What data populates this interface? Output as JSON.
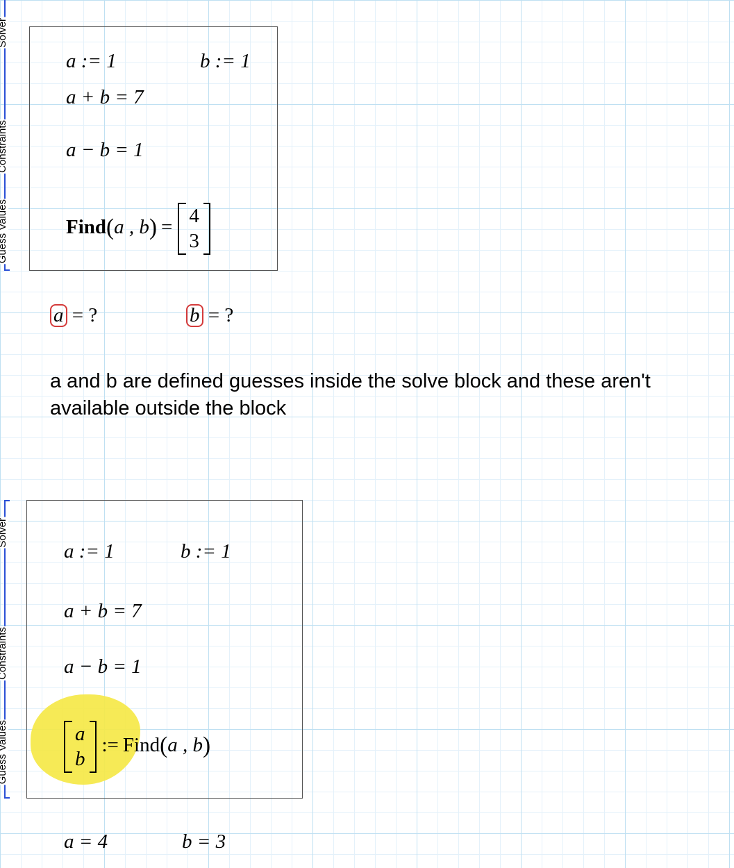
{
  "rail1": {
    "labels": [
      "Solver",
      "Constraints",
      "Guess Values"
    ]
  },
  "rail2": {
    "labels": [
      "Solver",
      "Constraints",
      "Guess Values"
    ]
  },
  "block1": {
    "guess_a": "a := 1",
    "guess_b": "b := 1",
    "eq1": "a + b = 7",
    "eq2": "a − b = 1",
    "find_label": "Find",
    "find_args": "a , b",
    "result_top": "4",
    "result_bot": "3"
  },
  "errors": {
    "a_var": "a",
    "a_rest": " = ?",
    "b_var": "b",
    "b_rest": " = ?"
  },
  "note": "a and b are defined guesses inside the solve block and these aren't available outside the block",
  "block2": {
    "guess_a": "a := 1",
    "guess_b": "b := 1",
    "eq1": "a + b = 7",
    "eq2": "a − b = 1",
    "assign_top": "a",
    "assign_bot": "b",
    "assign_op": ":=",
    "find_label": "Find",
    "find_args": "a , b"
  },
  "results": {
    "a": "a = 4",
    "b": "b = 3"
  }
}
